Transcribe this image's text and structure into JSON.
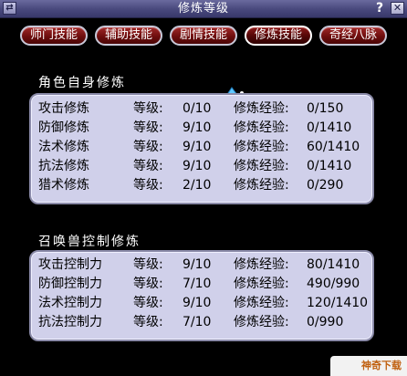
{
  "window": {
    "title": "修炼等级",
    "help_label": "?",
    "close_label": "✕",
    "sys_icon_label": "⇄"
  },
  "tabs": [
    {
      "label": "师门技能",
      "active": false
    },
    {
      "label": "辅助技能",
      "active": false
    },
    {
      "label": "剧情技能",
      "active": false
    },
    {
      "label": "修炼技能",
      "active": true
    },
    {
      "label": "奇经八脉",
      "active": false
    }
  ],
  "self_section": {
    "title": "角色自身修炼",
    "level_label": "等级:",
    "exp_label": "修炼经验:",
    "rows": [
      {
        "name": "攻击修炼",
        "level": "0/10",
        "exp": "0/150"
      },
      {
        "name": "防御修炼",
        "level": "9/10",
        "exp": "0/1410"
      },
      {
        "name": "法术修炼",
        "level": "9/10",
        "exp": "60/1410"
      },
      {
        "name": "抗法修炼",
        "level": "9/10",
        "exp": "0/1410"
      },
      {
        "name": "猎术修炼",
        "level": "2/10",
        "exp": "0/290"
      }
    ]
  },
  "pet_section": {
    "title": "召唤兽控制修炼",
    "level_label": "等级:",
    "exp_label": "修炼经验:",
    "rows": [
      {
        "name": "攻击控制力",
        "level": "9/10",
        "exp": "80/1410"
      },
      {
        "name": "防御控制力",
        "level": "7/10",
        "exp": "490/990"
      },
      {
        "name": "法术控制力",
        "level": "9/10",
        "exp": "120/1410"
      },
      {
        "name": "抗法控制力",
        "level": "7/10",
        "exp": "0/990"
      }
    ]
  },
  "watermark": {
    "label": "神奇下载"
  },
  "colors": {
    "panel_bg": "#d0d0ea",
    "tab_red": "#6e0e0e",
    "titlebar": "#4a4a7e"
  }
}
